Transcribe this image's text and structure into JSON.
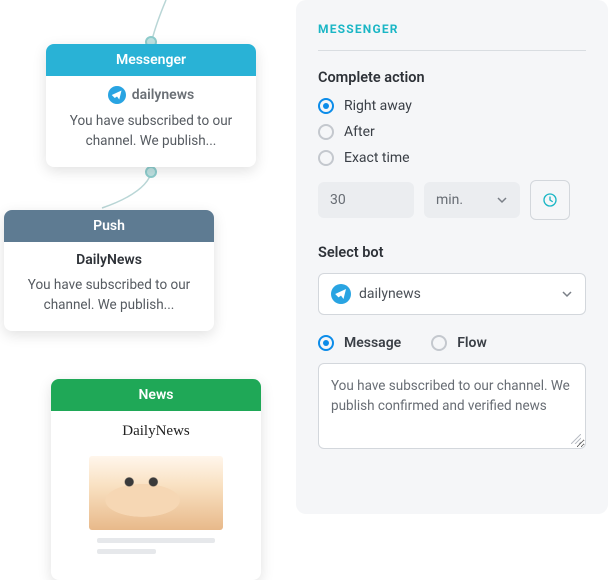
{
  "nodes": {
    "messenger": {
      "header": "Messenger",
      "bot_name": "dailynews",
      "body": "You have subscribed to our channel. We publish..."
    },
    "push": {
      "header": "Push",
      "title": "DailyNews",
      "body": "You have subscribed to our channel. We publish..."
    },
    "news": {
      "header": "News",
      "title": "DailyNews"
    }
  },
  "panel": {
    "title": "MESSENGER",
    "complete_action": {
      "label": "Complete action",
      "options": {
        "right_away": "Right away",
        "after": "After",
        "exact_time": "Exact time"
      },
      "selected": "right_away",
      "delay_value": "30",
      "delay_unit": "min."
    },
    "select_bot": {
      "label": "Select bot",
      "value": "dailynews"
    },
    "message_type": {
      "options": {
        "message": "Message",
        "flow": "Flow"
      },
      "selected": "message",
      "text": "You have subscribed to our channel. We publish confirmed and verified news"
    }
  }
}
